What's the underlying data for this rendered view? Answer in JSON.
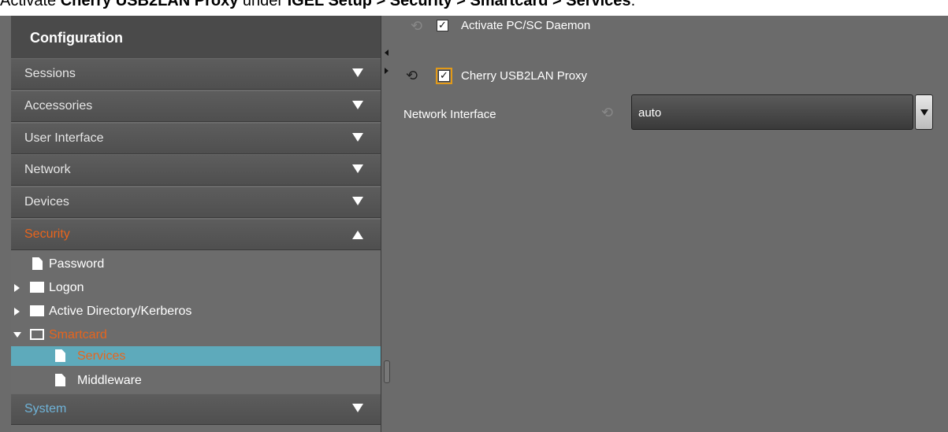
{
  "instruction": {
    "prefix": "Activate ",
    "bold1": "Cherry USB2LAN Proxy",
    "mid": " under ",
    "bold2": "IGEL Setup > Security > Smartcard > Services",
    "suffix": "."
  },
  "sidebar": {
    "title": "Configuration",
    "sections": [
      {
        "label": "Sessions",
        "state": "collapsed"
      },
      {
        "label": "Accessories",
        "state": "collapsed"
      },
      {
        "label": "User Interface",
        "state": "collapsed"
      },
      {
        "label": "Network",
        "state": "collapsed"
      },
      {
        "label": "Devices",
        "state": "collapsed"
      },
      {
        "label": "Security",
        "state": "expanded"
      },
      {
        "label": "System",
        "state": "collapsed"
      }
    ],
    "tree": [
      {
        "label": "Password",
        "icon": "file-icon"
      },
      {
        "label": "Logon",
        "icon": "folder-icon"
      },
      {
        "label": "Active Directory/Kerberos",
        "icon": "folder-icon"
      },
      {
        "label": "Smartcard",
        "icon": "folder-open-icon"
      },
      {
        "label": "Services",
        "icon": "file-icon",
        "selected": true
      },
      {
        "label": "Middleware",
        "icon": "file-icon"
      }
    ]
  },
  "content": {
    "pcsc_label": "Activate PC/SC Daemon",
    "pcsc_checked": true,
    "cherry_label": "Cherry USB2LAN Proxy",
    "cherry_checked": true,
    "network_interface_label": "Network Interface",
    "network_interface_value": "auto"
  },
  "colors": {
    "active_section": "#e8641c",
    "system_section": "#6fb3d8",
    "selection": "#5eaabb",
    "focus": "#e39a18"
  }
}
